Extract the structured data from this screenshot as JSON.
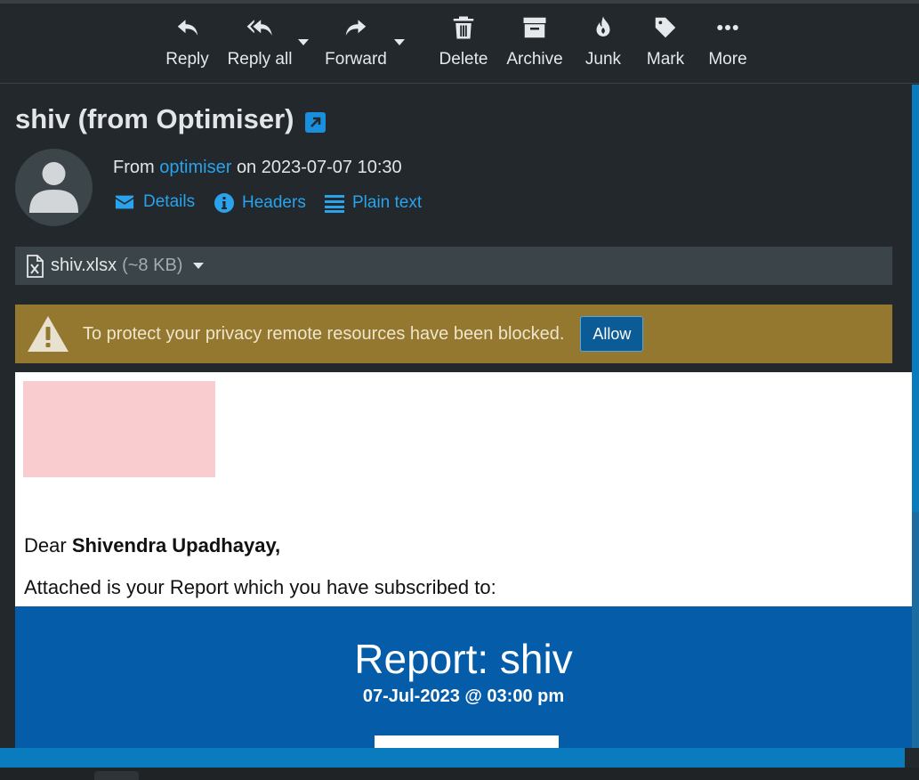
{
  "toolbar": {
    "reply": "Reply",
    "reply_all": "Reply all",
    "forward": "Forward",
    "delete": "Delete",
    "archive": "Archive",
    "junk": "Junk",
    "mark": "Mark",
    "more": "More"
  },
  "message": {
    "subject": "shiv (from Optimiser)",
    "from_prefix": "From",
    "sender": "optimiser",
    "date_text": "on 2023-07-07 10:30",
    "details": "Details",
    "headers": "Headers",
    "plain_text": "Plain text"
  },
  "attachment": {
    "name": "shiv.xlsx",
    "size": "(~8 KB)"
  },
  "privacy": {
    "message": "To protect your privacy remote resources have been blocked.",
    "allow": "Allow"
  },
  "email_body": {
    "greeting_prefix": "Dear",
    "recipient": "Shivendra Upadhayay,",
    "intro": "Attached is your Report which you have subscribed to:",
    "report_title": "Report: shiv",
    "report_date": "07-Jul-2023 @ 03:00 pm"
  },
  "colors": {
    "background": "#22282c",
    "link": "#2aa3ec",
    "warning": "#94782f",
    "report_banner": "#055ca8"
  }
}
